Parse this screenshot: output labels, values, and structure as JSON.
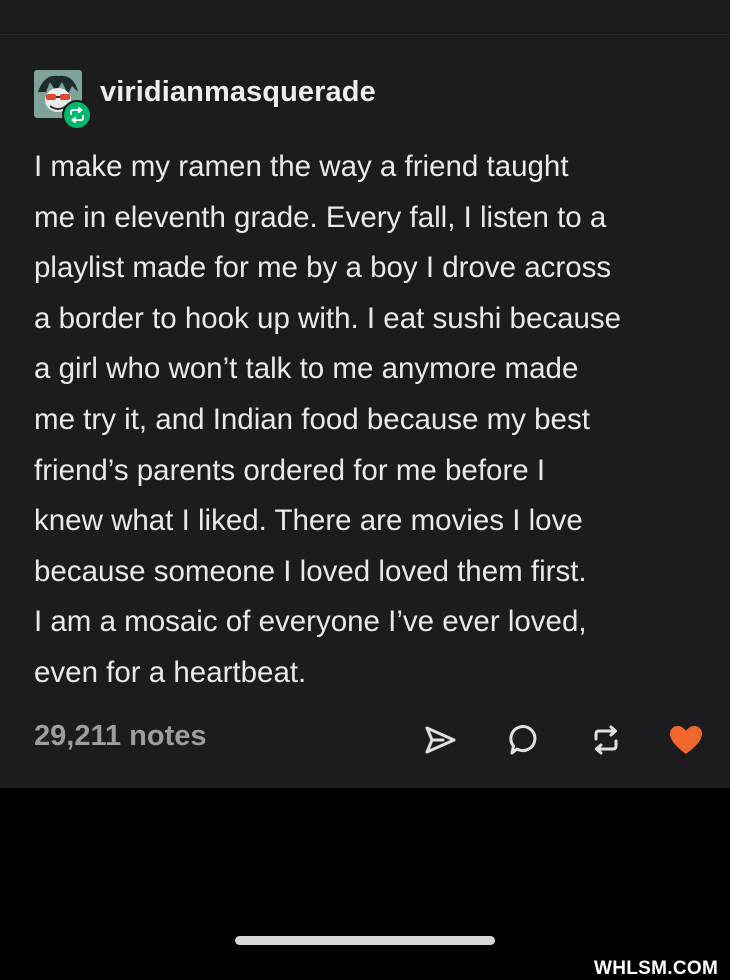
{
  "post": {
    "username": "viridianmasquerade",
    "body_lines": [
      "I make my ramen the way a friend taught",
      "me in eleventh grade. Every fall, I listen to a",
      "playlist made for me by a boy I drove across",
      "a border to hook up with. I eat sushi because",
      "a girl who won’t talk to me anymore made",
      "me try it, and Indian food because my best",
      "friend’s parents ordered for me before I",
      "knew what I liked. There are movies I love",
      "because someone I loved loved them first.",
      "I am a mosaic of everyone I’ve ever loved,",
      "even for a heartbeat."
    ],
    "notes": "29,211 notes"
  },
  "actions": {
    "share_icon": "share-icon",
    "reply_icon": "reply-icon",
    "reblog_icon": "reblog-icon",
    "like_icon": "heart-icon"
  },
  "colors": {
    "background": "#1c1c1e",
    "text": "#e9e9e9",
    "muted": "#9d9d9d",
    "reblog_green": "#00b86b",
    "like_orange": "#f0672c"
  },
  "watermark": "WHLSM.COM"
}
